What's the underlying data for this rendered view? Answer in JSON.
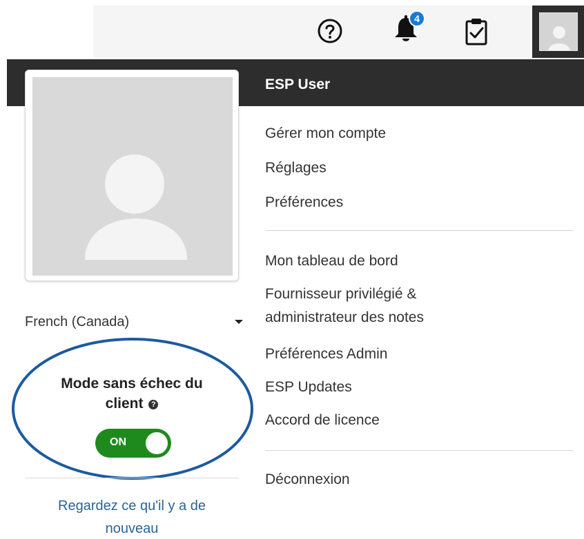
{
  "topbar": {
    "notifications_count": "4",
    "icons": [
      "help-icon",
      "bell-icon",
      "clipboard-check-icon",
      "user-avatar-icon"
    ]
  },
  "menu": {
    "username": "ESP User",
    "group1": [
      "Gérer mon compte",
      "Réglages",
      "Préférences"
    ],
    "group2": {
      "dashboard": "Mon tableau de bord",
      "preferred_vendor_line1": "Fournisseur privilégié &",
      "preferred_vendor_line2": "administrateur des notes",
      "admin_prefs": "Préférences Admin",
      "esp_updates": "ESP Updates",
      "license": "Accord de licence"
    },
    "logout": "Déconnexion"
  },
  "profile": {
    "language": "French (Canada)",
    "safe_mode_title_line1": "Mode sans échec du",
    "safe_mode_title_line2": "client",
    "safe_mode_help_icon": "?",
    "safe_mode_state": "ON",
    "whats_new_line1": "Regardez ce qu'il y a de",
    "whats_new_line2": "nouveau"
  },
  "colors": {
    "header_dark": "#2d2d2d",
    "badge_blue": "#1a7bd4",
    "toggle_green": "#1e8a1e",
    "link_blue": "#2a6496",
    "ellipse_blue": "#1c5aa0"
  }
}
